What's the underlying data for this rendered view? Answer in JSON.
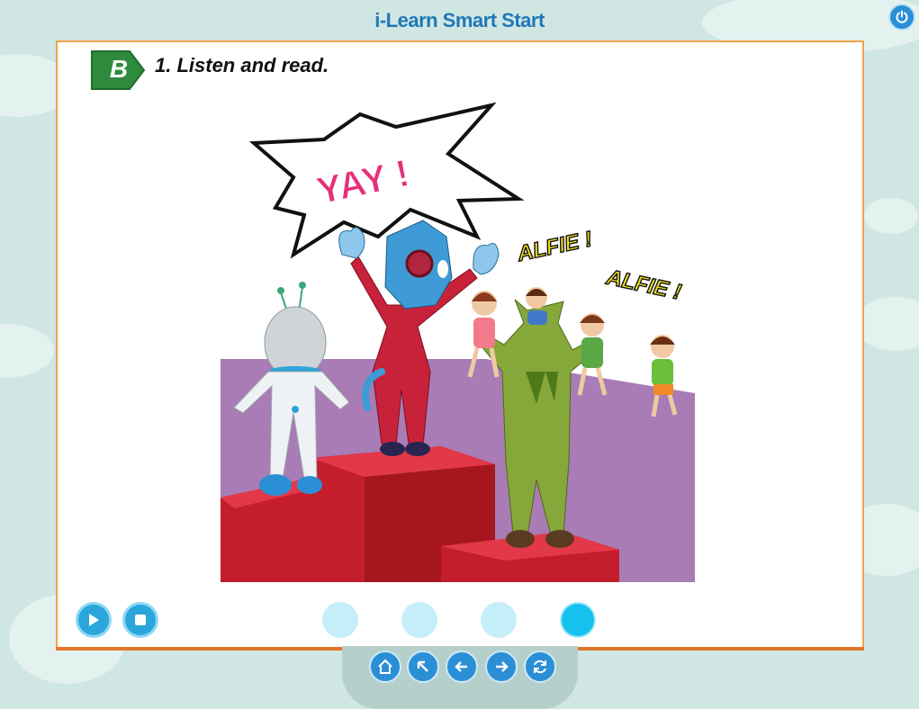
{
  "app": {
    "title": "i-Learn Smart Start"
  },
  "lesson": {
    "badge_letter": "B",
    "instruction": "1. Listen and read."
  },
  "scene": {
    "speech_text": "YAY !",
    "chant_1": "ALFIE !",
    "chant_2": "ALFIE !"
  },
  "player": {
    "controls": [
      "play-icon",
      "stop-icon"
    ],
    "page_dots": {
      "count": 4,
      "active_index": 3
    }
  },
  "navigation": {
    "buttons": [
      "home-icon",
      "arrow-up-left-icon",
      "arrow-left-icon",
      "arrow-right-icon",
      "refresh-icon"
    ]
  },
  "colors": {
    "accent_blue": "#2b8fd6",
    "page_border": "#f0a24a",
    "badge_green": "#2e8b3e",
    "dot_active": "#15c2ee",
    "dot_inactive": "#c6eef8",
    "background": "#cfe6e2"
  }
}
